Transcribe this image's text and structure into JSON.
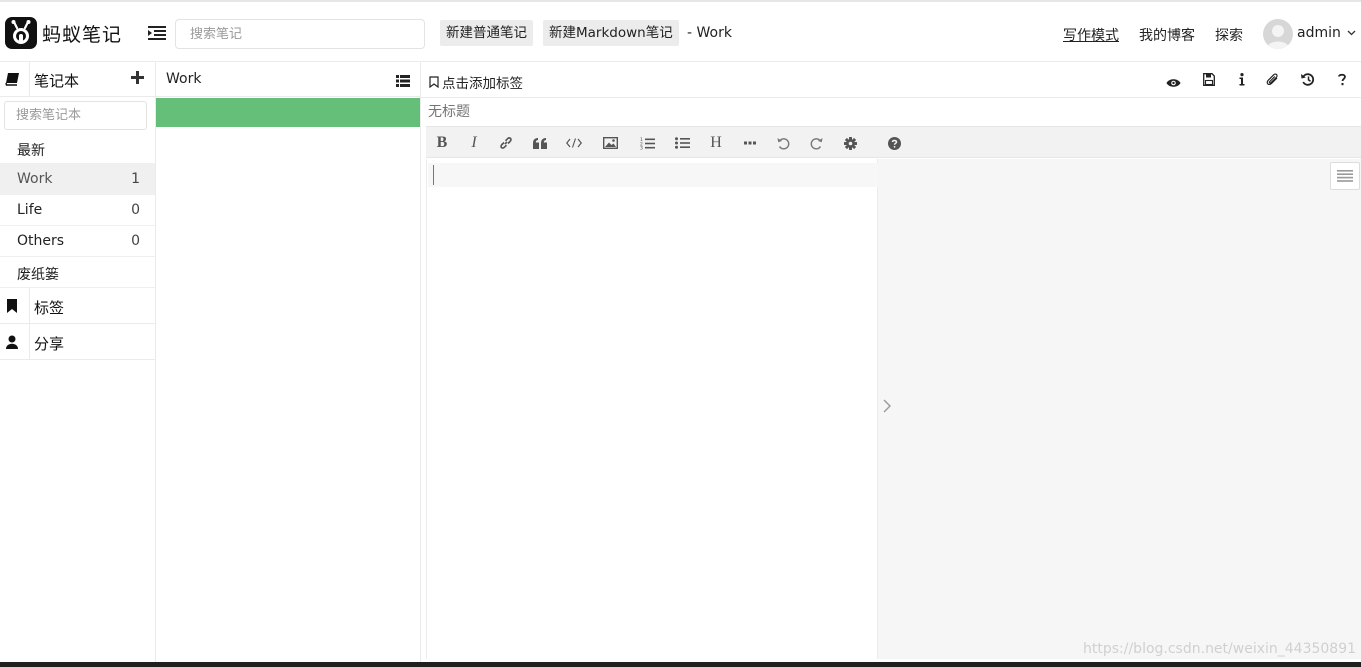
{
  "header": {
    "logo_text": "蚂蚁笔记",
    "search_placeholder": "搜索笔记",
    "new_normal_note": "新建普通笔记",
    "new_markdown_note": "新建Markdown笔记",
    "current_notebook": "- Work",
    "nav": {
      "write_mode": "写作模式",
      "my_blog": "我的博客",
      "explore": "探索"
    },
    "username": "admin"
  },
  "sidebar": {
    "notebooks_label": "笔记本",
    "notebook_search_placeholder": "搜索笔记本",
    "items": [
      {
        "name": "最新",
        "count": ""
      },
      {
        "name": "Work",
        "count": "1"
      },
      {
        "name": "Life",
        "count": "0"
      },
      {
        "name": "Others",
        "count": "0"
      },
      {
        "name": "废纸篓",
        "count": ""
      }
    ],
    "tags_label": "标签",
    "share_label": "分享"
  },
  "notelist": {
    "title": "Work"
  },
  "editor": {
    "add_tag": "点击添加标签",
    "title_placeholder": "无标题",
    "toolbar_heading": "H"
  },
  "watermark": "https://blog.csdn.net/weixin_44350891",
  "colors": {
    "selected_note": "#65bf79",
    "selected_notebook": "#f0f0f0"
  }
}
